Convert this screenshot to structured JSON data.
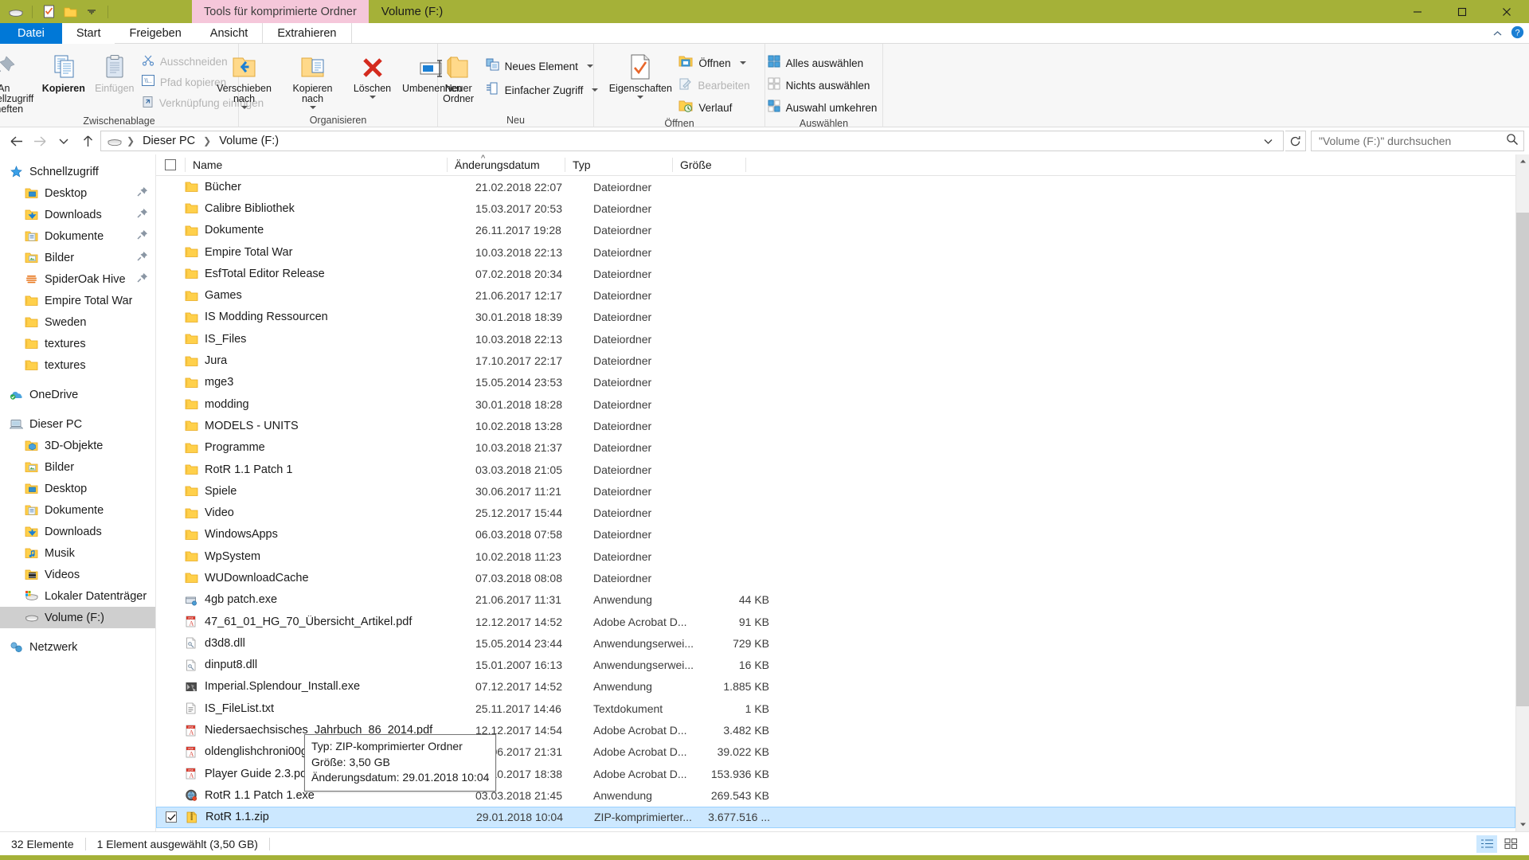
{
  "window": {
    "title": "Volume (F:)",
    "context_tab": "Tools für komprimierte Ordner",
    "minimize": "Minimieren",
    "maximize": "Maximieren",
    "close": "Schließen"
  },
  "quick_access_toolbar": {
    "drive_icon": "drive-icon",
    "properties_icon": "properties-icon",
    "new_folder_icon": "new-folder-icon",
    "customize_icon": "chevron-down-icon"
  },
  "ribbon_tabs": [
    {
      "label": "Datei",
      "kind": "file"
    },
    {
      "label": "Start",
      "kind": "active"
    },
    {
      "label": "Freigeben",
      "kind": "normal"
    },
    {
      "label": "Ansicht",
      "kind": "normal"
    },
    {
      "label": "Extrahieren",
      "kind": "ctx"
    }
  ],
  "ribbon_right": {
    "collapse_icon": "chevron-up-icon",
    "help_icon": "help-icon"
  },
  "ribbon": {
    "groups": [
      {
        "name": "Zwischenablage",
        "label": "Zwischenablage",
        "big_buttons": [
          {
            "label": "An Schnellzugriff\nanheften",
            "icon": "pin-icon",
            "disabled": false
          },
          {
            "label": "Kopieren",
            "icon": "copy-icon",
            "disabled": false
          },
          {
            "label": "Einfügen",
            "icon": "paste-icon",
            "disabled": true
          }
        ],
        "small_buttons": [
          {
            "label": "Ausschneiden",
            "icon": "scissors-icon",
            "disabled": true
          },
          {
            "label": "Pfad kopieren",
            "icon": "copy-path-icon",
            "disabled": true
          },
          {
            "label": "Verknüpfung einfügen",
            "icon": "paste-shortcut-icon",
            "disabled": true
          }
        ]
      },
      {
        "name": "Organisieren",
        "label": "Organisieren",
        "big_buttons": [
          {
            "label": "Verschieben\nnach",
            "icon": "move-to-icon",
            "dropdown": true
          },
          {
            "label": "Kopieren\nnach",
            "icon": "copy-to-icon",
            "dropdown": true
          },
          {
            "label": "Löschen",
            "icon": "delete-icon",
            "dropdown": true
          },
          {
            "label": "Umbenennen",
            "icon": "rename-icon",
            "dropdown": false
          }
        ]
      },
      {
        "name": "Neu",
        "label": "Neu",
        "big_buttons": [
          {
            "label": "Neuer\nOrdner",
            "icon": "new-folder-icon"
          }
        ],
        "small_buttons": [
          {
            "label": "Neues Element",
            "icon": "new-item-icon",
            "dropdown": true
          },
          {
            "label": "Einfacher Zugriff",
            "icon": "easy-access-icon",
            "dropdown": true
          }
        ]
      },
      {
        "name": "Öffnen",
        "label": "Öffnen",
        "big_buttons": [
          {
            "label": "Eigenschaften",
            "icon": "properties-icon",
            "dropdown": true
          }
        ],
        "small_buttons": [
          {
            "label": "Öffnen",
            "icon": "open-icon",
            "dropdown": true,
            "disabled": false
          },
          {
            "label": "Bearbeiten",
            "icon": "edit-icon",
            "disabled": true
          },
          {
            "label": "Verlauf",
            "icon": "history-icon",
            "disabled": false
          }
        ]
      },
      {
        "name": "Auswählen",
        "label": "Auswählen",
        "small_buttons": [
          {
            "label": "Alles auswählen",
            "icon": "select-all-icon"
          },
          {
            "label": "Nichts auswählen",
            "icon": "select-none-icon"
          },
          {
            "label": "Auswahl umkehren",
            "icon": "invert-selection-icon"
          }
        ]
      }
    ]
  },
  "navigation": {
    "back_icon": "arrow-left-icon",
    "forward_icon": "arrow-right-icon",
    "recent_icon": "chevron-down-icon",
    "up_icon": "arrow-up-icon",
    "breadcrumb": [
      "Dieser PC",
      "Volume (F:)"
    ],
    "breadcrumb_icon": "drive-icon",
    "dropdown_icon": "chevron-down-icon",
    "refresh_icon": "refresh-icon"
  },
  "search": {
    "placeholder": "\"Volume (F:)\" durchsuchen",
    "icon": "search-icon"
  },
  "sidebar": {
    "items": [
      {
        "label": "Schnellzugriff",
        "icon": "star-icon",
        "level": 0,
        "pinned": false,
        "selected": false
      },
      {
        "label": "Desktop",
        "icon": "folder-desktop-icon",
        "level": 1,
        "pinned": true,
        "selected": false
      },
      {
        "label": "Downloads",
        "icon": "folder-downloads-icon",
        "level": 1,
        "pinned": true,
        "selected": false
      },
      {
        "label": "Dokumente",
        "icon": "folder-documents-icon",
        "level": 1,
        "pinned": true,
        "selected": false
      },
      {
        "label": "Bilder",
        "icon": "folder-pictures-icon",
        "level": 1,
        "pinned": true,
        "selected": false
      },
      {
        "label": "SpiderOak Hive",
        "icon": "spideroak-icon",
        "level": 1,
        "pinned": true,
        "selected": false
      },
      {
        "label": "Empire Total War",
        "icon": "folder-icon",
        "level": 1,
        "pinned": false,
        "selected": false
      },
      {
        "label": "Sweden",
        "icon": "folder-icon",
        "level": 1,
        "pinned": false,
        "selected": false
      },
      {
        "label": "textures",
        "icon": "folder-icon",
        "level": 1,
        "pinned": false,
        "selected": false
      },
      {
        "label": "textures",
        "icon": "folder-icon",
        "level": 1,
        "pinned": false,
        "selected": false
      },
      {
        "gap": true
      },
      {
        "label": "OneDrive",
        "icon": "onedrive-icon",
        "level": 0,
        "pinned": false,
        "selected": false
      },
      {
        "gap": true
      },
      {
        "label": "Dieser PC",
        "icon": "this-pc-icon",
        "level": 0,
        "pinned": false,
        "selected": false
      },
      {
        "label": "3D-Objekte",
        "icon": "folder-3dobjects-icon",
        "level": 1,
        "pinned": false,
        "selected": false
      },
      {
        "label": "Bilder",
        "icon": "folder-pictures-icon",
        "level": 1,
        "pinned": false,
        "selected": false
      },
      {
        "label": "Desktop",
        "icon": "folder-desktop-icon",
        "level": 1,
        "pinned": false,
        "selected": false
      },
      {
        "label": "Dokumente",
        "icon": "folder-documents-icon",
        "level": 1,
        "pinned": false,
        "selected": false
      },
      {
        "label": "Downloads",
        "icon": "folder-downloads-icon",
        "level": 1,
        "pinned": false,
        "selected": false
      },
      {
        "label": "Musik",
        "icon": "folder-music-icon",
        "level": 1,
        "pinned": false,
        "selected": false
      },
      {
        "label": "Videos",
        "icon": "folder-videos-icon",
        "level": 1,
        "pinned": false,
        "selected": false
      },
      {
        "label": "Lokaler Datenträger",
        "icon": "local-disk-icon",
        "level": 1,
        "pinned": false,
        "selected": false
      },
      {
        "label": "Volume (F:)",
        "icon": "drive-icon",
        "level": 1,
        "pinned": false,
        "selected": true
      },
      {
        "gap": true
      },
      {
        "label": "Netzwerk",
        "icon": "network-icon",
        "level": 0,
        "pinned": false,
        "selected": false
      }
    ]
  },
  "filelist": {
    "columns": [
      "Name",
      "Änderungsdatum",
      "Typ",
      "Größe"
    ],
    "sort_column": "Name",
    "sort_direction": "ascending",
    "rows": [
      {
        "name": "Bücher",
        "date": "21.02.2018 22:07",
        "type": "Dateiordner",
        "size": "",
        "icon": "folder-icon",
        "selected": false
      },
      {
        "name": "Calibre Bibliothek",
        "date": "15.03.2017 20:53",
        "type": "Dateiordner",
        "size": "",
        "icon": "folder-icon",
        "selected": false
      },
      {
        "name": "Dokumente",
        "date": "26.11.2017 19:28",
        "type": "Dateiordner",
        "size": "",
        "icon": "folder-icon",
        "selected": false
      },
      {
        "name": "Empire Total War",
        "date": "10.03.2018 22:13",
        "type": "Dateiordner",
        "size": "",
        "icon": "folder-icon",
        "selected": false
      },
      {
        "name": "EsfTotal Editor Release",
        "date": "07.02.2018 20:34",
        "type": "Dateiordner",
        "size": "",
        "icon": "folder-icon",
        "selected": false
      },
      {
        "name": "Games",
        "date": "21.06.2017 12:17",
        "type": "Dateiordner",
        "size": "",
        "icon": "folder-icon",
        "selected": false
      },
      {
        "name": "IS Modding Ressourcen",
        "date": "30.01.2018 18:39",
        "type": "Dateiordner",
        "size": "",
        "icon": "folder-icon",
        "selected": false
      },
      {
        "name": "IS_Files",
        "date": "10.03.2018 22:13",
        "type": "Dateiordner",
        "size": "",
        "icon": "folder-icon",
        "selected": false
      },
      {
        "name": "Jura",
        "date": "17.10.2017 22:17",
        "type": "Dateiordner",
        "size": "",
        "icon": "folder-icon",
        "selected": false
      },
      {
        "name": "mge3",
        "date": "15.05.2014 23:53",
        "type": "Dateiordner",
        "size": "",
        "icon": "folder-icon",
        "selected": false
      },
      {
        "name": "modding",
        "date": "30.01.2018 18:28",
        "type": "Dateiordner",
        "size": "",
        "icon": "folder-icon",
        "selected": false
      },
      {
        "name": "MODELS - UNITS",
        "date": "10.02.2018 13:28",
        "type": "Dateiordner",
        "size": "",
        "icon": "folder-icon",
        "selected": false
      },
      {
        "name": "Programme",
        "date": "10.03.2018 21:37",
        "type": "Dateiordner",
        "size": "",
        "icon": "folder-icon",
        "selected": false
      },
      {
        "name": "RotR 1.1 Patch 1",
        "date": "03.03.2018 21:05",
        "type": "Dateiordner",
        "size": "",
        "icon": "folder-icon",
        "selected": false
      },
      {
        "name": "Spiele",
        "date": "30.06.2017 11:21",
        "type": "Dateiordner",
        "size": "",
        "icon": "folder-icon",
        "selected": false
      },
      {
        "name": "Video",
        "date": "25.12.2017 15:44",
        "type": "Dateiordner",
        "size": "",
        "icon": "folder-icon",
        "selected": false
      },
      {
        "name": "WindowsApps",
        "date": "06.03.2018 07:58",
        "type": "Dateiordner",
        "size": "",
        "icon": "folder-icon",
        "selected": false
      },
      {
        "name": "WpSystem",
        "date": "10.02.2018 11:23",
        "type": "Dateiordner",
        "size": "",
        "icon": "folder-icon",
        "selected": false
      },
      {
        "name": "WUDownloadCache",
        "date": "07.03.2018 08:08",
        "type": "Dateiordner",
        "size": "",
        "icon": "folder-icon",
        "selected": false
      },
      {
        "name": "4gb patch.exe",
        "date": "21.06.2017 11:31",
        "type": "Anwendung",
        "size": "44 KB",
        "icon": "exe-icon",
        "selected": false
      },
      {
        "name": "47_61_01_HG_70_Übersicht_Artikel.pdf",
        "date": "12.12.2017 14:52",
        "type": "Adobe Acrobat D...",
        "size": "91 KB",
        "icon": "pdf-icon",
        "selected": false
      },
      {
        "name": "d3d8.dll",
        "date": "15.05.2014 23:44",
        "type": "Anwendungserwei...",
        "size": "729 KB",
        "icon": "dll-icon",
        "selected": false
      },
      {
        "name": "dinput8.dll",
        "date": "15.01.2007 16:13",
        "type": "Anwendungserwei...",
        "size": "16 KB",
        "icon": "dll-icon",
        "selected": false
      },
      {
        "name": "Imperial.Splendour_Install.exe",
        "date": "07.12.2017 14:52",
        "type": "Anwendung",
        "size": "1.885 KB",
        "icon": "app-icon",
        "selected": false
      },
      {
        "name": "IS_FileList.txt",
        "date": "25.11.2017 14:46",
        "type": "Textdokument",
        "size": "1 KB",
        "icon": "txt-icon",
        "selected": false
      },
      {
        "name": "Niedersaechsisches_Jahrbuch_86_2014.pdf",
        "date": "12.12.2017 14:54",
        "type": "Adobe Acrobat D...",
        "size": "3.482 KB",
        "icon": "pdf-icon",
        "selected": false
      },
      {
        "name": "oldenglishchroni00gileuoft.pdf",
        "date": "08.06.2017 21:31",
        "type": "Adobe Acrobat D...",
        "size": "39.022 KB",
        "icon": "pdf-icon",
        "selected": false
      },
      {
        "name": "Player Guide 2.3.pdf",
        "date": "13.10.2017 18:38",
        "type": "Adobe Acrobat D...",
        "size": "153.936 KB",
        "icon": "pdf-icon",
        "selected": false
      },
      {
        "name": "RotR 1.1 Patch 1.exe",
        "date": "03.03.2018 21:45",
        "type": "Anwendung",
        "size": "269.543 KB",
        "icon": "app-globe-icon",
        "selected": false
      },
      {
        "name": "RotR 1.1.zip",
        "date": "29.01.2018 10:04",
        "type": "ZIP-komprimierter...",
        "size": "3.677.516 ...",
        "icon": "zip-icon",
        "selected": true
      }
    ]
  },
  "tooltip": {
    "line1": "Typ: ZIP-komprimierter Ordner",
    "line2": "Größe: 3,50 GB",
    "line3": "Änderungsdatum: 29.01.2018 10:04"
  },
  "statusbar": {
    "item_count": "32 Elemente",
    "selection": "1 Element ausgewählt (3,50 GB)",
    "details_view_icon": "details-view-icon",
    "large_icons_view_icon": "large-icons-view-icon"
  },
  "colors": {
    "titlebar": "#a5b138",
    "context_tab": "#f5c7da",
    "file_tab": "#0078d7",
    "selection": "#cce8ff",
    "nav_selection": "#cfcfcf",
    "folder_yellow": "#ffd04b",
    "delete_red": "#d42b1e"
  }
}
